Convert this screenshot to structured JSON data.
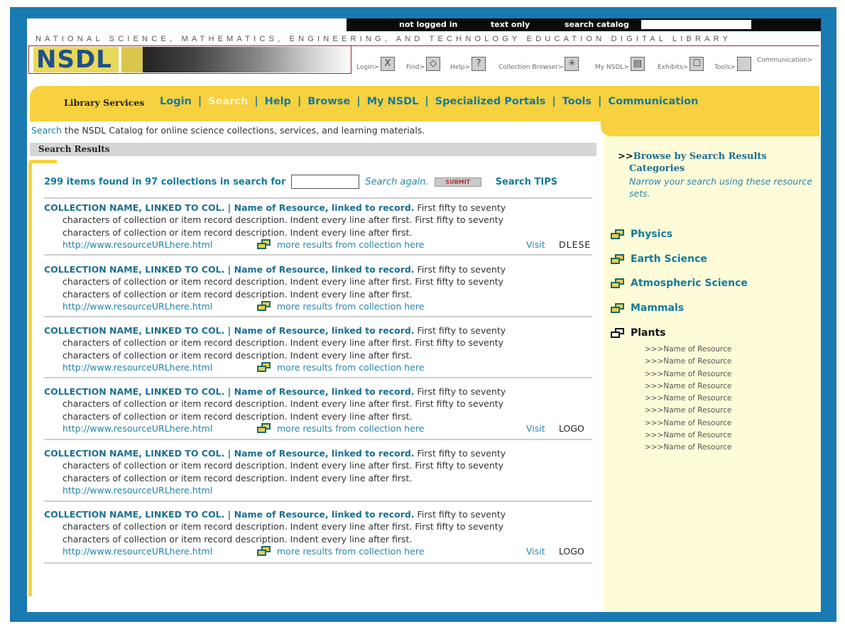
{
  "topbar": {
    "not_logged_in": "not logged in",
    "text_only": "text only",
    "search_catalog": "search catalog"
  },
  "banner": {
    "title": "NATIONAL SCIENCE, MATHEMATICS, ENGINEERING, AND TECHNOLOGY EDUCATION DIGITAL LIBRARY",
    "logo": "NSDL"
  },
  "nav_icons": [
    {
      "label": "Login>",
      "icon": "close-icon",
      "glyph": "X"
    },
    {
      "label": "Find>",
      "icon": "find-icon",
      "glyph": "◇"
    },
    {
      "label": "Help>",
      "icon": "help-icon",
      "glyph": "?"
    },
    {
      "label": "Collection Browser>",
      "icon": "collection-browser-icon",
      "glyph": "✳"
    },
    {
      "label": "My NSDL>",
      "icon": "my-nsdl-icon",
      "glyph": "▤"
    },
    {
      "label": "Exhibits>",
      "icon": "exhibits-icon",
      "glyph": "☐"
    },
    {
      "label": "Tools>",
      "icon": "tools-icon",
      "glyph": ""
    },
    {
      "label": "Communication>",
      "icon": "communication-icon",
      "glyph": ""
    }
  ],
  "services": {
    "label": "Library Services",
    "items": [
      "Login",
      "Search",
      "Help",
      "Browse",
      "My NSDL",
      "Specialized Portals",
      "Tools",
      "Communication"
    ]
  },
  "tagline": {
    "link": "Search",
    "rest": " the NSDL Catalog for online science collections, services, and learning materials."
  },
  "results": {
    "header": "Search Results",
    "summary": "299 items found in 97 collections in search for",
    "search_again": "Search again.",
    "submit": "SUBMIT",
    "tips": "Search TIPS",
    "items": [
      {
        "collection": "COLLECTION NAME, LINKED TO COL.",
        "sep": " | ",
        "resource": "Name of Resource, linked to record.",
        "line1": " First fifty to seventy",
        "line2": "characters of collection or item record description. Indent every line after first. First fifty to seventy",
        "line3": "characters of collection or item record description. Indent every line after first.",
        "url": "http://www.resourceURLhere.html",
        "more": "more results from collection here",
        "visit": "Visit",
        "logo": "DLESE"
      },
      {
        "collection": "COLLECTION NAME, LINKED TO COL.",
        "sep": " | ",
        "resource": "Name of Resource, linked to record.",
        "line1": " First fifty to seventy",
        "line2": "characters of collection or item record description. Indent every line after first. First fifty to seventy",
        "line3": "characters of collection or item record description. Indent every line after first.",
        "url": "http://www.resourceURLhere.html",
        "more": "more results from collection here",
        "visit": "",
        "logo": ""
      },
      {
        "collection": "COLLECTION NAME, LINKED TO COL.",
        "sep": " | ",
        "resource": "Name of Resource, linked to record.",
        "line1": " First fifty to seventy",
        "line2": "characters of collection or item record description. Indent every line after first. First fifty to seventy",
        "line3": "characters of collection or item record description. Indent every line after first.",
        "url": "http://www.resourceURLhere.html",
        "more": "more results from collection here",
        "visit": "",
        "logo": ""
      },
      {
        "collection": "COLLECTION NAME, LINKED TO COL.",
        "sep": " | ",
        "resource": "Name of Resource, linked to record.",
        "line1": " First fifty to seventy",
        "line2": "characters of collection or item record description. Indent every line after first. First fifty to seventy",
        "line3": "characters of collection or item record description. Indent every line after first.",
        "url": "http://www.resourceURLhere.html",
        "more": "more results from collection here",
        "visit": "Visit",
        "logo": "LOGO"
      },
      {
        "collection": "COLLECTION NAME, LINKED TO COL.",
        "sep": " | ",
        "resource": "Name of Resource, linked to record.",
        "line1": " First fifty to seventy",
        "line2": "characters of collection or item record description. Indent every line after first. First fifty to seventy",
        "line3": "characters of collection or item record description. Indent every line after first.",
        "url": "http://www.resourceURLhere.html",
        "more": "",
        "visit": "",
        "logo": ""
      },
      {
        "collection": "COLLECTION NAME, LINKED TO COL.",
        "sep": " | ",
        "resource": "Name of Resource, linked to record.",
        "line1": " First fifty to seventy",
        "line2": "characters of collection or item record description. Indent every line after first. First fifty to seventy",
        "line3": "characters of collection or item record description. Indent every line after first.",
        "url": "http://www.resourceURLhere.html",
        "more": "more results from collection here",
        "visit": "Visit",
        "logo": "LOGO"
      }
    ]
  },
  "sidebar": {
    "arrows": ">>",
    "title_line1": "Browse by Search Results",
    "title_line2": "Categories",
    "subtitle": "Narrow your search using these resource sets.",
    "categories": [
      "Physics",
      "Earth Science",
      "Atmospheric Science",
      "Mammals",
      "Plants"
    ],
    "plant_resources": [
      ">>>Name of Resource",
      ">>>Name of Resource",
      ">>>Name of Resource",
      ">>>Name of Resource",
      ">>>Name of Resource",
      ">>>Name of Resource",
      ">>>Name of Resource",
      ">>>Name of Resource",
      ">>>Name of Resource"
    ]
  },
  "colors": {
    "frame": "#1a7ab2",
    "yellow": "#f7d13f",
    "teal_link": "#157a9c",
    "sidebar_bg": "#fefbd8"
  }
}
